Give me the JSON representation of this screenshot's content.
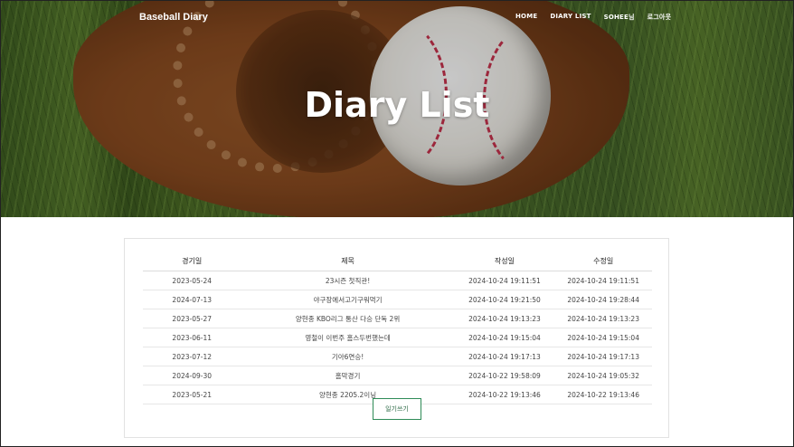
{
  "header": {
    "brand": "Baseball Diary",
    "nav": [
      "HOME",
      "DIARY LIST",
      "SOHEE님",
      "로그아웃"
    ],
    "title": "Diary List"
  },
  "table": {
    "columns": [
      "경기일",
      "제목",
      "작성일",
      "수정일"
    ],
    "rows": [
      [
        "2023-05-24",
        "23시즌 첫직관!",
        "2024-10-24 19:11:51",
        "2024-10-24 19:11:51"
      ],
      [
        "2024-07-13",
        "야구장에서고기구워먹기",
        "2024-10-24 19:21:50",
        "2024-10-24 19:28:44"
      ],
      [
        "2023-05-27",
        "양현종 KBO리그 통산 다승 단독 2위",
        "2024-10-24 19:13:23",
        "2024-10-24 19:13:23"
      ],
      [
        "2023-06-11",
        "영철이 이번주 홈스두번했는데",
        "2024-10-24 19:15:04",
        "2024-10-24 19:15:04"
      ],
      [
        "2023-07-12",
        "기아6연승!",
        "2024-10-24 19:17:13",
        "2024-10-24 19:17:13"
      ],
      [
        "2024-09-30",
        "홈막경기",
        "2024-10-22 19:58:09",
        "2024-10-24 19:05:32"
      ],
      [
        "2023-05-21",
        "양현종 2205.2이닝",
        "2024-10-22 19:13:46",
        "2024-10-22 19:13:46"
      ]
    ]
  },
  "actions": {
    "write_label": "일기쓰기"
  }
}
